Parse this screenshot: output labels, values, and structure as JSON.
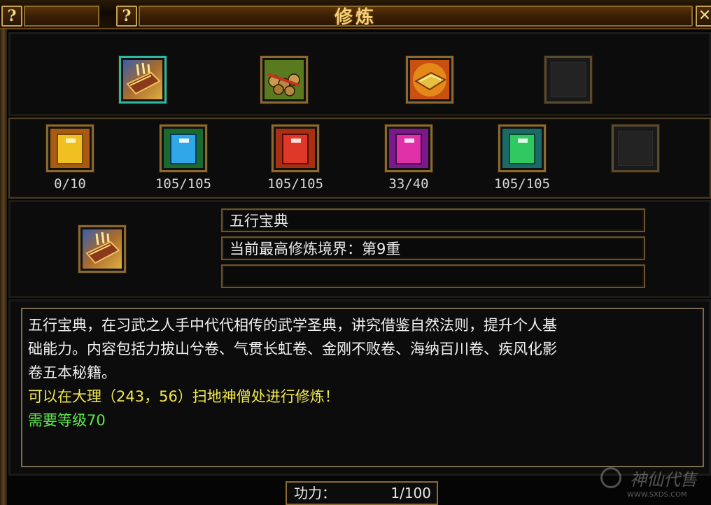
{
  "window": {
    "title": "修炼"
  },
  "buttons": {
    "help": "?",
    "close": "✕"
  },
  "top_row": [
    {
      "icon": "wuxing-book-icon",
      "selected": true
    },
    {
      "icon": "scroll-bundle-icon",
      "selected": false
    },
    {
      "icon": "gold-ingot-book-icon",
      "selected": false
    },
    {
      "icon": "empty-slot",
      "selected": false
    }
  ],
  "books": [
    {
      "icon": "yellow-book-icon",
      "count": "0/10"
    },
    {
      "icon": "blue-book-icon",
      "count": "105/105"
    },
    {
      "icon": "red-book-icon",
      "count": "105/105"
    },
    {
      "icon": "magenta-book-icon",
      "count": "33/40"
    },
    {
      "icon": "green-book-icon",
      "count": "105/105"
    },
    {
      "icon": "empty-slot",
      "count": ""
    }
  ],
  "info": {
    "name": "五行宝典",
    "realm": "当前最高修炼境界：第9重",
    "extra": ""
  },
  "description": {
    "line1": "五行宝典，在习武之人手中代代相传的武学圣典，讲究借鉴自然法则，提升个人基",
    "line2": "础能力。内容包括力拔山兮卷、气贯长虹卷、金刚不败卷、海纳百川卷、疾风化影",
    "line3": "卷五本秘籍。",
    "location": "可以在大理（243，56）扫地神僧处进行修炼！",
    "requirement": "需要等级70"
  },
  "power": {
    "label": "功力：",
    "value": "1/100"
  },
  "watermark": {
    "text": "神仙代售",
    "url": "WWW.SXDS.COM"
  },
  "colors": {
    "gold": "#f4d27a",
    "yellow_text": "#f2e84a",
    "green_text": "#5ee84a",
    "selected_border": "#2fb8a0"
  }
}
